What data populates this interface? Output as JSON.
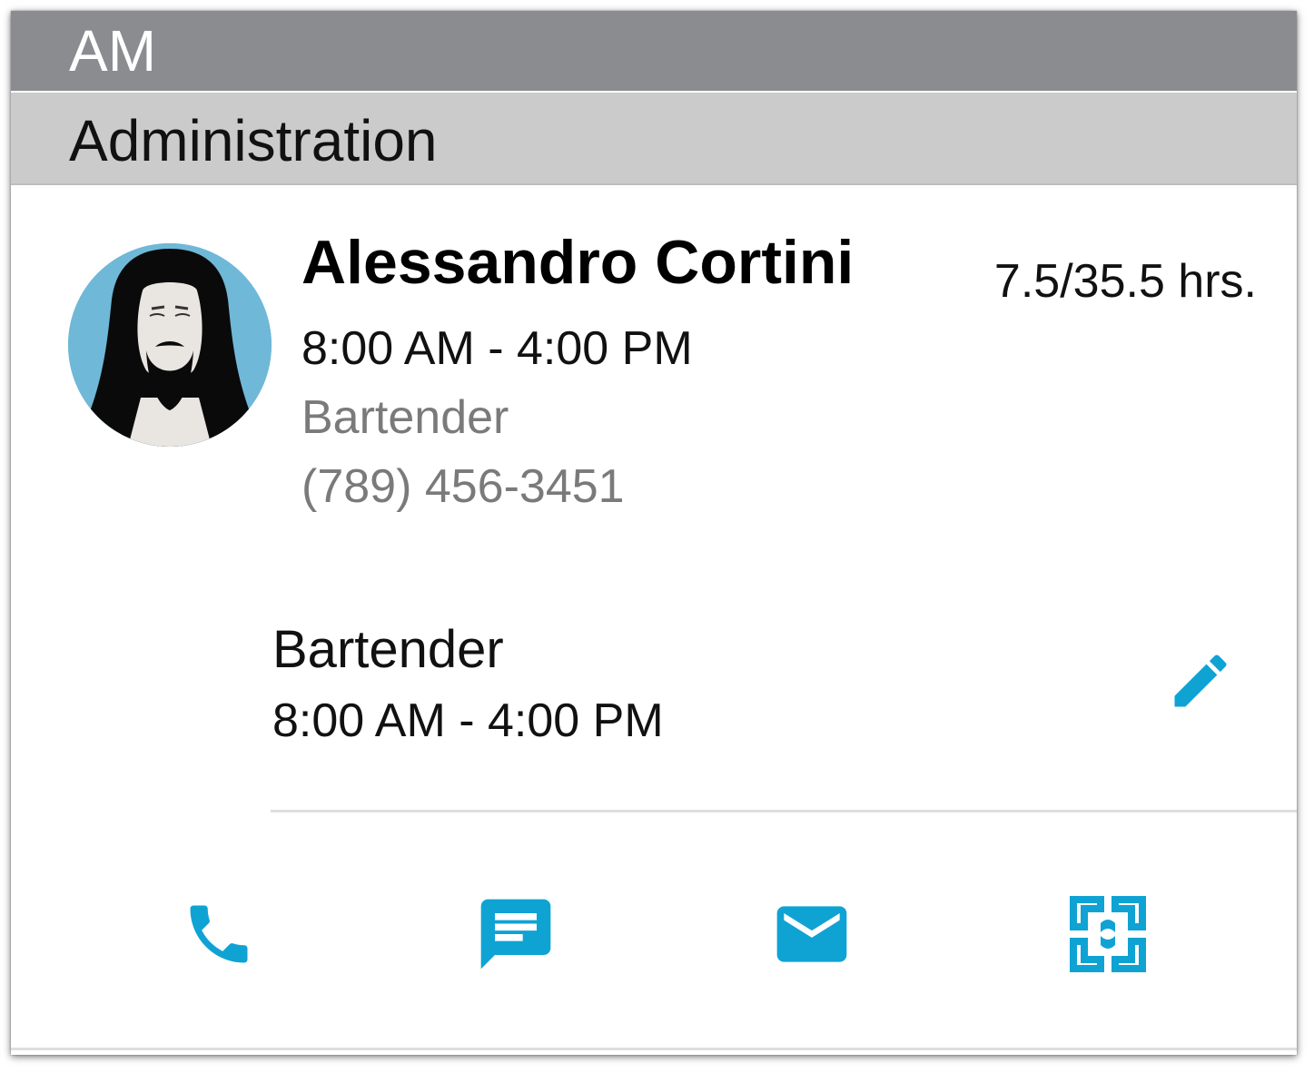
{
  "shift_header": {
    "label": "AM"
  },
  "department": {
    "label": "Administration"
  },
  "employee": {
    "name": "Alessandro Cortini",
    "hours": "7.5/35.5 hrs.",
    "time": "8:00 AM - 4:00 PM",
    "role": "Bartender",
    "phone": "(789) 456-3451"
  },
  "shift": {
    "role": "Bartender",
    "time": "8:00 AM - 4:00 PM",
    "edit_icon": "pencil-icon"
  },
  "actions": [
    {
      "icon": "phone-icon"
    },
    {
      "icon": "message-icon"
    },
    {
      "icon": "email-icon"
    },
    {
      "icon": "exchange-icon"
    }
  ],
  "colors": {
    "accent": "#0fa3d4",
    "shift_header_bg": "#8a8c90",
    "department_bg": "#cbcbcb",
    "secondary_text": "#7a7a7a"
  }
}
